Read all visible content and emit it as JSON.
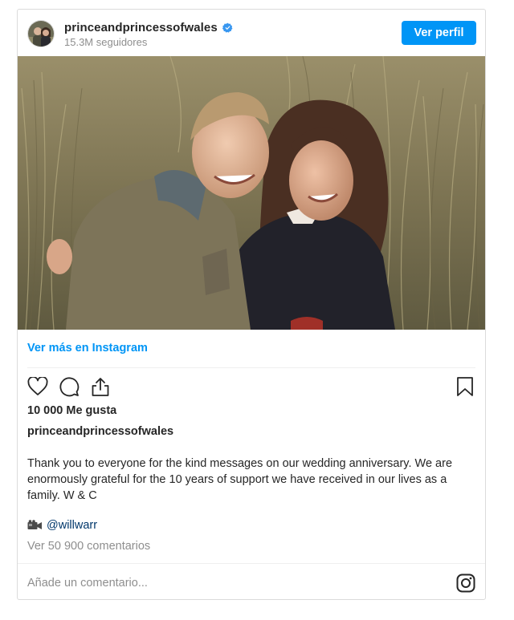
{
  "post": {
    "username": "princeandprincessofwales",
    "verified": true,
    "followers": "15.3M seguidores",
    "profile_button": "Ver perfil",
    "view_more": "Ver más en Instagram",
    "likes": "10 000 Me gusta",
    "caption_user": "princeandprincessofwales",
    "caption": "Thank you to everyone for the kind messages on our wedding anniversary. We are enormously grateful for the 10 years of support we have received in our lives as a family. W & C",
    "credit_emoji_icon": "video-camera-icon",
    "credit_handle": "@willwarr",
    "comments_link": "Ver 50 900 comentarios",
    "comment_placeholder": "Añade un comentario..."
  },
  "icons": {
    "like": "heart-icon",
    "comment": "comment-bubble-icon",
    "share": "share-icon",
    "save": "bookmark-icon",
    "footer": "instagram-logo-icon"
  },
  "colors": {
    "accent": "#0095f6",
    "text": "#262626",
    "muted": "#8e8e8e",
    "link_dark": "#00376b",
    "border": "#dbdbdb"
  }
}
